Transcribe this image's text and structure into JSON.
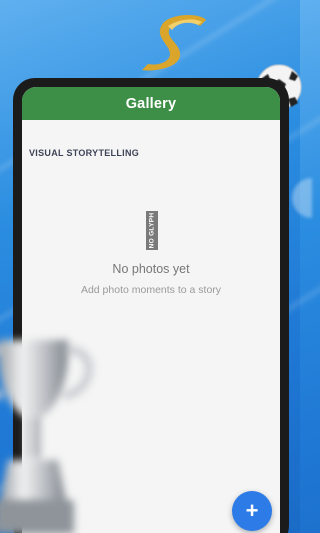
{
  "app_bar": {
    "title": "Gallery"
  },
  "section": {
    "heading": "VISUAL STORYTELLING"
  },
  "empty_state": {
    "icon_text": "NO GLYPH",
    "title": "No photos yet",
    "subtitle": "Add photo moments to a story"
  },
  "fab": {
    "label": "+",
    "icon": "plus-icon"
  },
  "decorations": {
    "background_icon": "blue-gradient-background",
    "ribbon_icon": "gold-ribbon-icon",
    "ball_icon": "soccer-ball-icon",
    "trophy_icon": "trophy-icon"
  },
  "colors": {
    "app_bar": "#3d8f48",
    "fab": "#2d7be6",
    "background": "#1f78d4",
    "screen": "#f5f5f5"
  }
}
